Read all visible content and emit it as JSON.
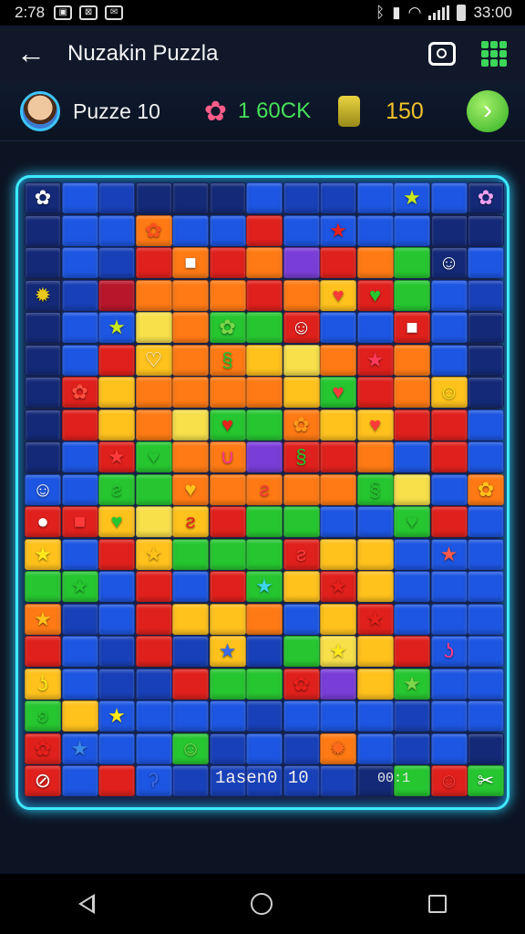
{
  "status_bar": {
    "time": "2:78",
    "right_time": "33:00",
    "icons": [
      "gallery-icon",
      "image-icon",
      "mail-icon"
    ]
  },
  "app_bar": {
    "title": "Nuzakin Puzzla",
    "back_icon": "arrow-left-icon",
    "camera_icon": "camera-icon",
    "menu_icon": "grid-menu-icon"
  },
  "hud": {
    "level_label": "Puzze 10",
    "score": "1 60CK",
    "coins": "150",
    "next_icon": "play-next-icon"
  },
  "board": {
    "bottom_label": "1asen0 10",
    "bottom_count": "00:1"
  },
  "colors": {
    "frame_glow": "#3ee9ff",
    "score_green": "#46e05a",
    "coin_yellow": "#f2c22a",
    "next_button": "#3cc62a"
  },
  "palette": {
    "B": "#1d56e2",
    "b": "#1840b8",
    "d": "#142a78",
    "R": "#e0201c",
    "O": "#ff7a14",
    "Y": "#ffc21c",
    "G": "#26c630",
    "g": "#7ed64a",
    "L": "#f7e04a",
    "P": "#7a3ed8",
    "K": "#b8162a"
  },
  "grid": [
    "dBbdddBbbBBBd",
    "dBBOBBRBBBBdd",
    "dBbROROPROGdB",
    "dbKOOOROYRGBb",
    "dBBLOGGRBBRBd",
    "dBRYOOYLOROBd",
    "dRYOOOOYGROYd",
    "dRYOLGGOYYRRB",
    "dBRGOOPRROBRB",
    "BBGGOOOOOGLBO",
    "RRYLYRGGBBGRB",
    "YBRYGGGRYYBBB",
    "GGBRBRGYRYBBB",
    "ObBRYYOBYRBBB",
    "RBbRbYbGLYRBB",
    "YBbbRGGRPYGBB",
    "GYBBBBbBBBbBB",
    "RBBBGbBbOBbBd",
    "RBRBbbbbbdGRG"
  ],
  "pieces": [
    {
      "r": 0,
      "c": 0,
      "g": "✿",
      "col": "#ffffff",
      "name": "bunny-piece"
    },
    {
      "r": 0,
      "c": 10,
      "g": "★",
      "col": "#c8e81c",
      "name": "star-piece"
    },
    {
      "r": 0,
      "c": 12,
      "g": "✿",
      "col": "#f0a0f0",
      "name": "flower-piece"
    },
    {
      "r": 1,
      "c": 3,
      "g": "✿",
      "col": "#ff5020",
      "name": "flower-piece"
    },
    {
      "r": 1,
      "c": 8,
      "g": "★",
      "col": "#e8201c",
      "name": "star-piece"
    },
    {
      "r": 2,
      "c": 4,
      "g": "■",
      "col": "#ffffff",
      "name": "box-piece"
    },
    {
      "r": 2,
      "c": 11,
      "g": "☺",
      "col": "#ffffff",
      "name": "face-piece"
    },
    {
      "r": 3,
      "c": 0,
      "g": "✹",
      "col": "#e8c81c",
      "name": "sun-piece"
    },
    {
      "r": 3,
      "c": 8,
      "g": "♥",
      "col": "#ff3a3a",
      "name": "heart-piece"
    },
    {
      "r": 3,
      "c": 9,
      "g": "♥",
      "col": "#26c630",
      "name": "heart-piece"
    },
    {
      "r": 4,
      "c": 2,
      "g": "★",
      "col": "#c8e81c",
      "name": "star-piece"
    },
    {
      "r": 4,
      "c": 5,
      "g": "✿",
      "col": "#7ed64a",
      "name": "flower-piece"
    },
    {
      "r": 4,
      "c": 7,
      "g": "☺",
      "col": "#ffffff",
      "name": "face-piece"
    },
    {
      "r": 4,
      "c": 10,
      "g": "■",
      "col": "#ffffff",
      "name": "box-piece"
    },
    {
      "r": 5,
      "c": 3,
      "g": "♡",
      "col": "#ffffff",
      "name": "heart-piece"
    },
    {
      "r": 5,
      "c": 5,
      "g": "§",
      "col": "#26c630",
      "name": "snake-piece"
    },
    {
      "r": 5,
      "c": 9,
      "g": "★",
      "col": "#ff3a5a",
      "name": "star-piece"
    },
    {
      "r": 6,
      "c": 1,
      "g": "✿",
      "col": "#ff5040",
      "name": "flower-piece"
    },
    {
      "r": 6,
      "c": 8,
      "g": "♥",
      "col": "#ff3a3a",
      "name": "heart-piece"
    },
    {
      "r": 6,
      "c": 11,
      "g": "☺",
      "col": "#ffe81c",
      "name": "face-piece"
    },
    {
      "r": 7,
      "c": 5,
      "g": "♥",
      "col": "#e8201c",
      "name": "heart-piece"
    },
    {
      "r": 7,
      "c": 7,
      "g": "✿",
      "col": "#ff9a1c",
      "name": "flower-piece"
    },
    {
      "r": 7,
      "c": 9,
      "g": "♥",
      "col": "#ff3a3a",
      "name": "heart-piece"
    },
    {
      "r": 8,
      "c": 2,
      "g": "★",
      "col": "#ff3a3a",
      "name": "star-piece"
    },
    {
      "r": 8,
      "c": 3,
      "g": "♥",
      "col": "#26c630",
      "name": "heart-piece"
    },
    {
      "r": 8,
      "c": 5,
      "g": "∪",
      "col": "#ff3a8a",
      "name": "magnet-piece"
    },
    {
      "r": 8,
      "c": 7,
      "g": "§",
      "col": "#26c630",
      "name": "snake-piece"
    },
    {
      "r": 9,
      "c": 0,
      "g": "☺",
      "col": "#ffffff",
      "name": "face-piece"
    },
    {
      "r": 9,
      "c": 2,
      "g": "ƨ",
      "col": "#26c630",
      "name": "snake-piece"
    },
    {
      "r": 9,
      "c": 4,
      "g": "♥",
      "col": "#ffc21c",
      "name": "heart-piece"
    },
    {
      "r": 9,
      "c": 6,
      "g": "ƨ",
      "col": "#ff3a3a",
      "name": "snake-piece"
    },
    {
      "r": 9,
      "c": 9,
      "g": "§",
      "col": "#26c630",
      "name": "snake-piece"
    },
    {
      "r": 9,
      "c": 12,
      "g": "✿",
      "col": "#ffc21c",
      "name": "flower-piece"
    },
    {
      "r": 10,
      "c": 0,
      "g": "●",
      "col": "#ffffff",
      "name": "ball-piece"
    },
    {
      "r": 10,
      "c": 1,
      "g": "■",
      "col": "#ff3a3a",
      "name": "box-piece"
    },
    {
      "r": 10,
      "c": 2,
      "g": "♥",
      "col": "#26c630",
      "name": "heart-piece"
    },
    {
      "r": 10,
      "c": 4,
      "g": "ƨ",
      "col": "#e8201c",
      "name": "snake-piece"
    },
    {
      "r": 10,
      "c": 10,
      "g": "♥",
      "col": "#26c630",
      "name": "heart-piece"
    },
    {
      "r": 11,
      "c": 0,
      "g": "★",
      "col": "#ffe81c",
      "name": "star-piece"
    },
    {
      "r": 11,
      "c": 3,
      "g": "★",
      "col": "#ffc21c",
      "name": "star-piece"
    },
    {
      "r": 11,
      "c": 7,
      "g": "ƨ",
      "col": "#ff3a3a",
      "name": "snake-piece"
    },
    {
      "r": 11,
      "c": 11,
      "g": "★",
      "col": "#ff5a4a",
      "name": "star-piece"
    },
    {
      "r": 12,
      "c": 1,
      "g": "★",
      "col": "#26c630",
      "name": "star-piece"
    },
    {
      "r": 12,
      "c": 6,
      "g": "★",
      "col": "#3ad6e8",
      "name": "star-piece"
    },
    {
      "r": 12,
      "c": 8,
      "g": "★",
      "col": "#e8201c",
      "name": "star-piece"
    },
    {
      "r": 13,
      "c": 0,
      "g": "★",
      "col": "#ffc21c",
      "name": "star-piece"
    },
    {
      "r": 13,
      "c": 9,
      "g": "★",
      "col": "#e8201c",
      "name": "star-piece"
    },
    {
      "r": 14,
      "c": 5,
      "g": "★",
      "col": "#3a6ae8",
      "name": "star-piece"
    },
    {
      "r": 14,
      "c": 8,
      "g": "★",
      "col": "#ffe81c",
      "name": "star-piece"
    },
    {
      "r": 14,
      "c": 11,
      "g": "ʖ",
      "col": "#ff3a8a",
      "name": "hook-piece"
    },
    {
      "r": 15,
      "c": 0,
      "g": "ʖ",
      "col": "#ffe81c",
      "name": "duck-piece"
    },
    {
      "r": 15,
      "c": 7,
      "g": "✿",
      "col": "#e8201c",
      "name": "flower-piece"
    },
    {
      "r": 15,
      "c": 10,
      "g": "★",
      "col": "#7ed64a",
      "name": "star-piece"
    },
    {
      "r": 16,
      "c": 0,
      "g": "ʚ",
      "col": "#26c630",
      "name": "snake-piece"
    },
    {
      "r": 16,
      "c": 2,
      "g": "★",
      "col": "#ffe81c",
      "name": "star-piece"
    },
    {
      "r": 17,
      "c": 0,
      "g": "✿",
      "col": "#e8201c",
      "name": "flower-piece"
    },
    {
      "r": 17,
      "c": 1,
      "g": "★",
      "col": "#3a8ae8",
      "name": "star-piece"
    },
    {
      "r": 17,
      "c": 4,
      "g": "☺",
      "col": "#7ed64a",
      "name": "face-piece"
    },
    {
      "r": 17,
      "c": 8,
      "g": "✹",
      "col": "#ff6a1c",
      "name": "sun-piece"
    },
    {
      "r": 18,
      "c": 0,
      "g": "⊘",
      "col": "#ffffff",
      "name": "ball-piece"
    },
    {
      "r": 18,
      "c": 3,
      "g": "ʔ",
      "col": "#3a6ae8",
      "name": "hook-piece"
    },
    {
      "r": 18,
      "c": 11,
      "g": "☺",
      "col": "#ff3a3a",
      "name": "face-piece"
    },
    {
      "r": 18,
      "c": 12,
      "g": "✂",
      "col": "#ffffff",
      "name": "scissors-piece"
    }
  ]
}
